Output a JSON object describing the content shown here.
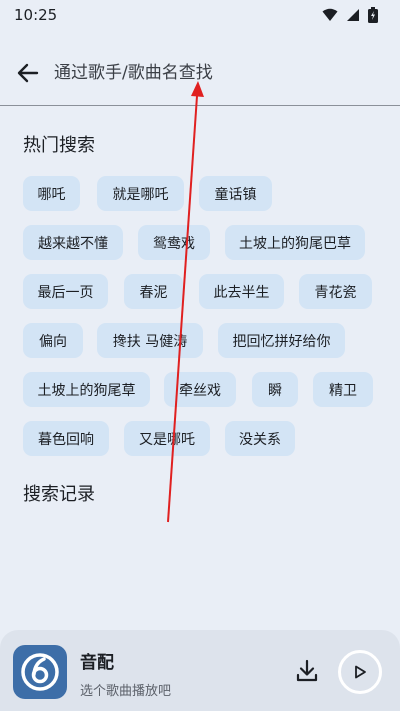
{
  "status_bar": {
    "time": "10:25",
    "icons": [
      "wifi-icon",
      "signal-icon",
      "battery-icon"
    ]
  },
  "search": {
    "placeholder": "通过歌手/歌曲名查找",
    "back_icon": "arrow-left-icon"
  },
  "hot_search": {
    "title": "热门搜索",
    "chips": [
      "哪吒",
      "就是哪吒",
      "童话镇",
      "越来越不懂",
      "鸳鸯戏",
      "土坡上的狗尾巴草",
      "最后一页",
      "春泥",
      "此去半生",
      "青花瓷",
      "偏向",
      "搀扶 马健涛",
      "把回忆拼好给你",
      "土坡上的狗尾草",
      "牵丝戏",
      "瞬",
      "精卫",
      "暮色回响",
      "又是哪吒",
      "没关系"
    ]
  },
  "history": {
    "title": "搜索记录"
  },
  "player": {
    "title": "音配",
    "subtitle": "选个歌曲播放吧",
    "art_icon": "music-app-logo-icon",
    "download_icon": "download-icon",
    "play_icon": "play-icon"
  },
  "colors": {
    "background": "#e9eef6",
    "chip": "#d3e4f5",
    "player_art": "#3d6ea8",
    "annotation_arrow": "#e02020"
  }
}
